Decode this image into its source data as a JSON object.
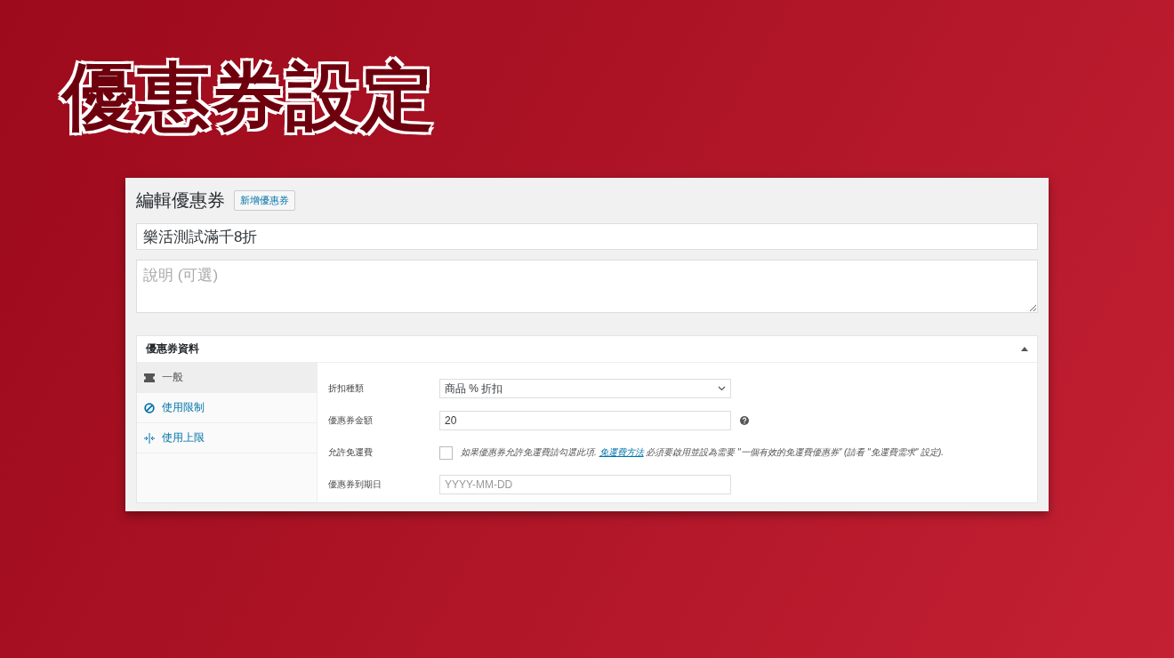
{
  "banner": {
    "title": "優惠券設定"
  },
  "page": {
    "heading": "編輯優惠券",
    "add_button": "新增優惠券"
  },
  "coupon_title": {
    "value": "樂活測試滿千8折"
  },
  "description": {
    "placeholder": "說明 (可選)"
  },
  "panel": {
    "title": "優惠券資料",
    "expanded": true,
    "tabs": [
      {
        "kind": "general",
        "label": "一般",
        "selected": true
      },
      {
        "kind": "restriction",
        "label": "使用限制",
        "selected": false
      },
      {
        "kind": "limit",
        "label": "使用上限",
        "selected": false
      }
    ],
    "fields": [
      {
        "kind": "select",
        "label": "折扣種類",
        "value": "商品 % 折扣",
        "help": false
      },
      {
        "kind": "input",
        "label": "優惠券金額",
        "value": "20",
        "help": true
      },
      {
        "kind": "checkbox",
        "label": "允許免運費",
        "checked": false,
        "help": false,
        "text_before": "如果優惠券允許免運費請勾選此項.",
        "link": "免運費方法",
        "text_after": "必須要啟用並設為需要 \"一個有效的免運費優惠券\" (請看 \"免運費需求\" 設定)."
      },
      {
        "kind": "date",
        "label": "優惠券到期日",
        "placeholder": "YYYY-MM-DD",
        "help": false
      }
    ]
  }
}
